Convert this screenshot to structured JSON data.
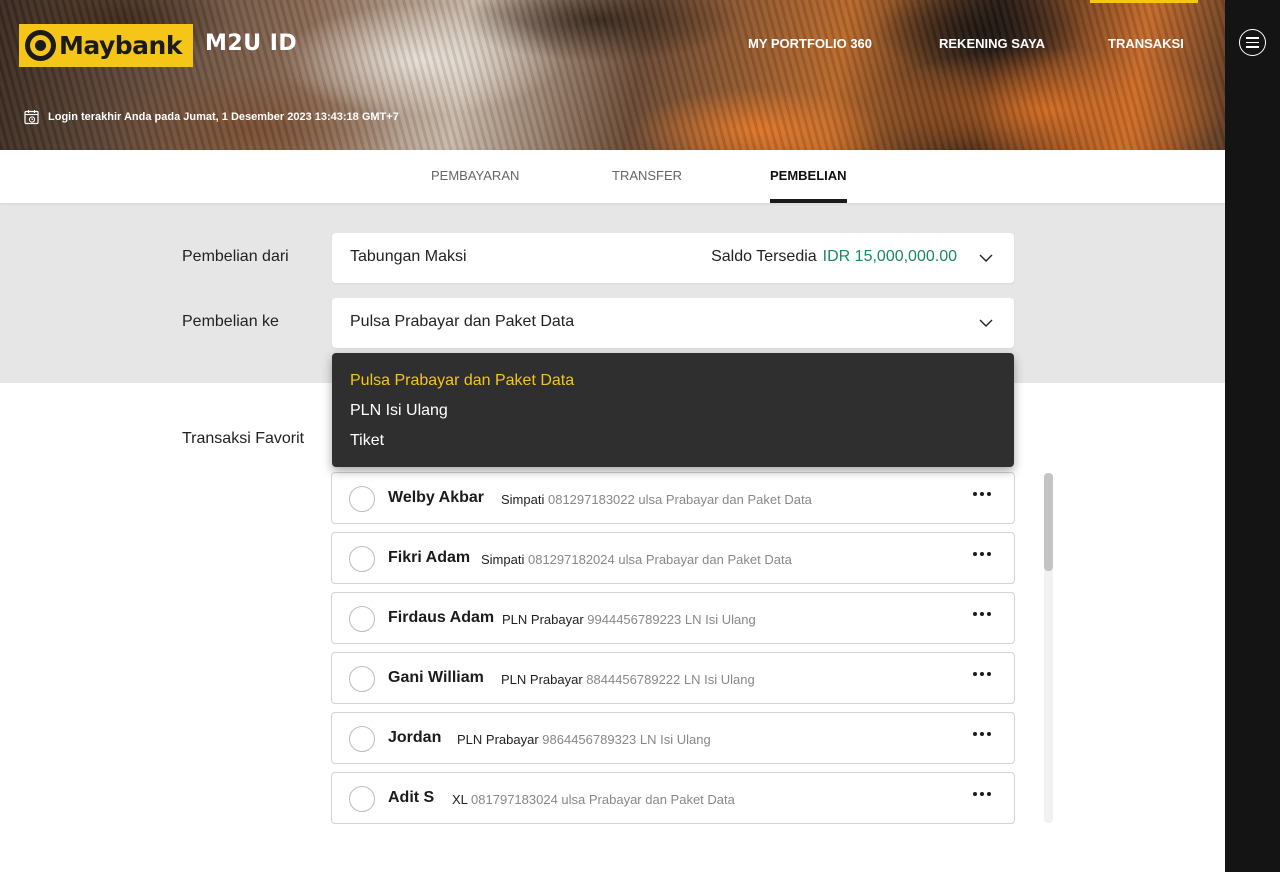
{
  "brand": {
    "logo_text": "Maybank",
    "app_name": "M2U ID",
    "accent_color": "#f5c518"
  },
  "top_nav": {
    "items": [
      "MY PORTFOLIO 360",
      "REKENING SAYA",
      "TRANSAKSI"
    ],
    "active": "TRANSAKSI"
  },
  "last_login": {
    "text": "Login terakhir Anda pada Jumat, 1 Desember 2023 13:43:18 GMT+7",
    "icon": "calendar-clock-icon"
  },
  "sub_tabs": {
    "items": [
      "PEMBAYARAN",
      "TRANSFER",
      "PEMBELIAN"
    ],
    "active": "PEMBELIAN"
  },
  "form": {
    "from_label": "Pembelian dari",
    "from_value": "Tabungan Maksi",
    "saldo_label": "Saldo Tersedia",
    "saldo_amount": "IDR 15,000,000.00",
    "saldo_color": "#1a8a5a",
    "to_label": "Pembelian ke",
    "to_value": "Pulsa Prabayar dan Paket Data"
  },
  "dropdown": {
    "options": [
      "Pulsa Prabayar dan Paket Data",
      "PLN Isi Ulang",
      "Tiket"
    ],
    "selected": "Pulsa Prabayar dan Paket Data"
  },
  "favorites": {
    "label": "Transaksi Favorit",
    "items": [
      {
        "name": "Welby Akbar",
        "provider": "Simpati",
        "detail": "081297183022 ulsa Prabayar dan Paket Data"
      },
      {
        "name": "Fikri Adam",
        "provider": "Simpati",
        "detail": "081297182024 ulsa Prabayar dan Paket Data"
      },
      {
        "name": "Firdaus Adam",
        "provider": "PLN Prabayar",
        "detail": "9944456789223 LN Isi Ulang"
      },
      {
        "name": "Gani William",
        "provider": "PLN Prabayar",
        "detail": "8844456789222 LN Isi Ulang"
      },
      {
        "name": "Jordan",
        "provider": "PLN Prabayar",
        "detail": "9864456789323 LN Isi Ulang"
      },
      {
        "name": "Adit S",
        "provider": "XL",
        "detail": "081797183024 ulsa Prabayar dan Paket Data"
      }
    ]
  }
}
